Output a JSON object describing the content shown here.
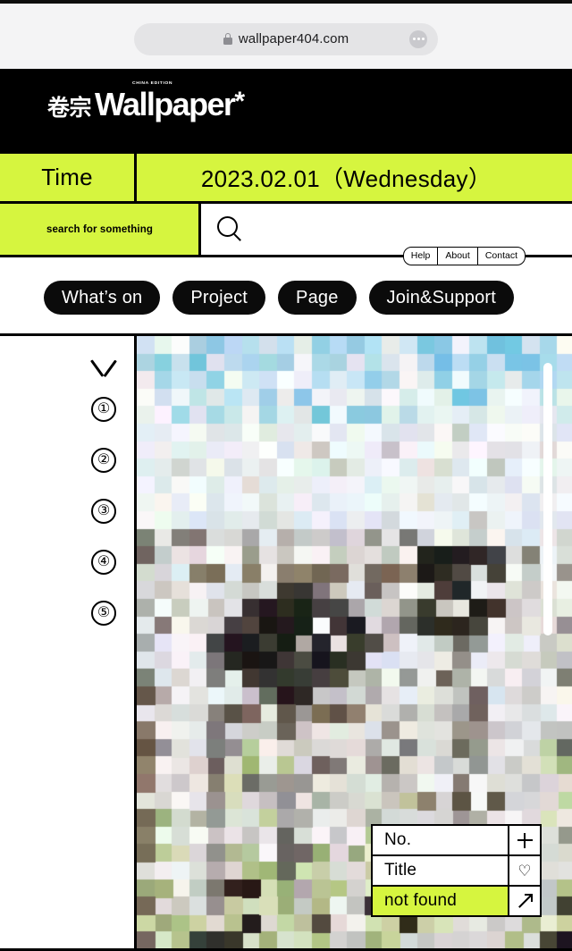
{
  "browser": {
    "url": "wallpaper404.com",
    "lock_icon": "lock-icon",
    "menu_icon": "three-dots-icon"
  },
  "masthead": {
    "logo_cn": "卷宗",
    "logo_edition": "CHINA EDITION",
    "logo_word": "Wallpaper",
    "logo_star": "*"
  },
  "time_row": {
    "label": "Time",
    "value": "2023.02.01（Wednesday）"
  },
  "search": {
    "hint": "search for something",
    "icon": "search-icon",
    "value": ""
  },
  "help_tabs": [
    {
      "label": "Help"
    },
    {
      "label": "About"
    },
    {
      "label": "Contact"
    }
  ],
  "nav": {
    "pills": [
      {
        "label": "What’s on"
      },
      {
        "label": "Project"
      },
      {
        "label": "Page"
      },
      {
        "label": "Join&Support"
      }
    ]
  },
  "sidebar": {
    "chevron_icon": "chevron-down-icon",
    "items": [
      {
        "label": "①"
      },
      {
        "label": "②"
      },
      {
        "label": "③"
      },
      {
        "label": "④"
      },
      {
        "label": "⑤"
      }
    ]
  },
  "info_card": {
    "rows": [
      {
        "label": "No.",
        "action_icon": "plus-icon",
        "highlight": false
      },
      {
        "label": "Title",
        "action_icon": "heart-icon",
        "highlight": false
      },
      {
        "label": "not found",
        "action_icon": "arrow-up-right-icon",
        "highlight": true
      }
    ],
    "heart_glyph": "♡"
  },
  "colors": {
    "accent": "#d6f53f",
    "ink": "#000000",
    "chrome": "#f4f4f5",
    "pill": "#0b0b0b"
  }
}
